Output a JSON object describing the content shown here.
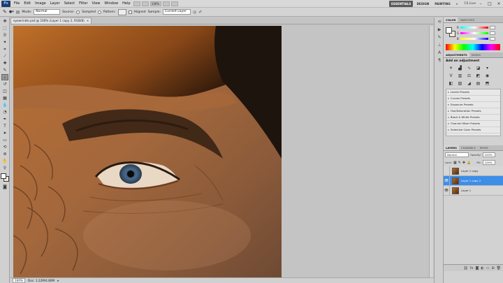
{
  "app": {
    "logo": "Ps",
    "menus": [
      "File",
      "Edit",
      "Image",
      "Layer",
      "Select",
      "Filter",
      "View",
      "Window",
      "Help"
    ],
    "zoom": "100%",
    "workspaces": [
      "ESSENTIALS",
      "DESIGN",
      "PAINTING"
    ],
    "active_workspace": "ESSENTIALS",
    "cs_live": "CS Live"
  },
  "options": {
    "mode_label": "Mode:",
    "mode_value": "Normal",
    "source_label": "Source:",
    "sampled": "Sampled",
    "pattern_label": "Pattern:",
    "aligned": "Aligned",
    "sample_label": "Sample:",
    "sample_value": "Current Layer"
  },
  "document": {
    "tab_title": "eyewrinkle.psd @ 100% (Layer 1 copy 2, RGB/8)",
    "close": "×",
    "zoom": "100%",
    "doc_info": "Doc: 1.22M/4.86M"
  },
  "color_panel": {
    "tabs": [
      "COLOR",
      "SWATCHES"
    ],
    "channels": [
      "R",
      "G",
      "B"
    ],
    "colors": {
      "r": "#e8463c",
      "g": "#4caf50",
      "b": "#3b6fe0"
    }
  },
  "adjustments": {
    "tabs": [
      "ADJUSTMENTS",
      "MASKS"
    ],
    "title": "Add an adjustment",
    "icons": [
      "brightness-icon",
      "levels-icon",
      "curves-icon",
      "exposure-icon",
      "hue-icon",
      "vibrance-icon",
      "hsl-icon",
      "color-balance-icon",
      "bw-icon",
      "photo-filter-icon",
      "invert-icon",
      "posterize-icon",
      "threshold-icon",
      "gradient-map-icon",
      "selective-color-icon"
    ],
    "presets": [
      "Levels Presets",
      "Curves Presets",
      "Exposure Presets",
      "Hue/Saturation Presets",
      "Black & White Presets",
      "Channel Mixer Presets",
      "Selective Color Presets"
    ]
  },
  "layers_panel": {
    "tabs": [
      "LAYERS",
      "CHANNELS",
      "PATHS"
    ],
    "blend_mode": "Normal",
    "opacity_label": "Opacity:",
    "opacity_value": "100%",
    "lock_label": "Lock:",
    "fill_label": "Fill:",
    "fill_value": "100%",
    "layers": [
      {
        "name": "Layer 1 copy",
        "visible": false,
        "selected": false
      },
      {
        "name": "Layer 1 copy 2",
        "visible": true,
        "selected": true
      },
      {
        "name": "Layer 1",
        "visible": true,
        "selected": false
      }
    ]
  }
}
